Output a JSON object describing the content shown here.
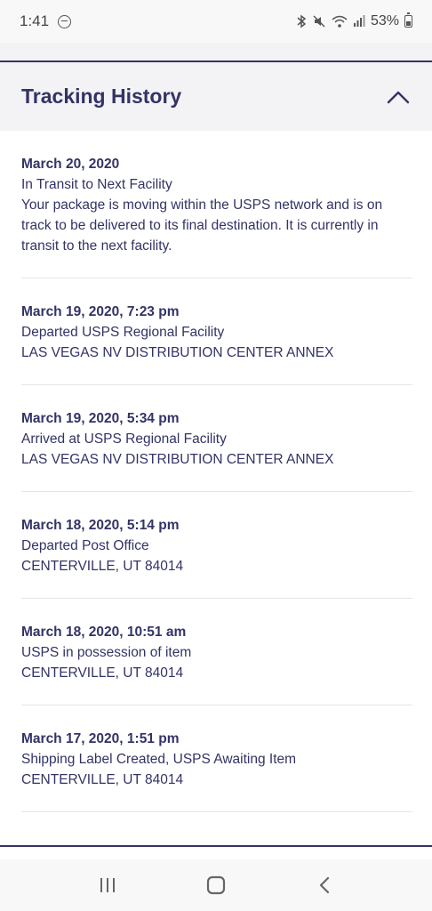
{
  "status_bar": {
    "time": "1:41",
    "battery": "53%"
  },
  "header": {
    "title": "Tracking History"
  },
  "events": [
    {
      "date": "March 20, 2020",
      "status": "In Transit to Next Facility",
      "detail": "Your package is moving within the USPS network and is on track to be delivered to its final destination. It is currently in transit to the next facility."
    },
    {
      "date": "March 19, 2020, 7:23 pm",
      "status": "Departed USPS Regional Facility",
      "detail": "LAS VEGAS NV DISTRIBUTION CENTER ANNEX"
    },
    {
      "date": "March 19, 2020, 5:34 pm",
      "status": "Arrived at USPS Regional Facility",
      "detail": "LAS VEGAS NV DISTRIBUTION CENTER ANNEX"
    },
    {
      "date": "March 18, 2020, 5:14 pm",
      "status": "Departed Post Office",
      "detail": "CENTERVILLE, UT 84014"
    },
    {
      "date": "March 18, 2020, 10:51 am",
      "status": "USPS in possession of item",
      "detail": "CENTERVILLE, UT 84014"
    },
    {
      "date": "March 17, 2020, 1:51 pm",
      "status": "Shipping Label Created, USPS Awaiting Item",
      "detail": "CENTERVILLE, UT 84014"
    }
  ],
  "icons": {
    "collapse": "chevron-up-icon",
    "nav_recents": "recent-apps-icon",
    "nav_home": "home-icon",
    "nav_back": "back-icon"
  },
  "colors": {
    "brand_navy": "#333366",
    "header_bg": "#f3f3f5",
    "divider": "#e5e5e8"
  }
}
